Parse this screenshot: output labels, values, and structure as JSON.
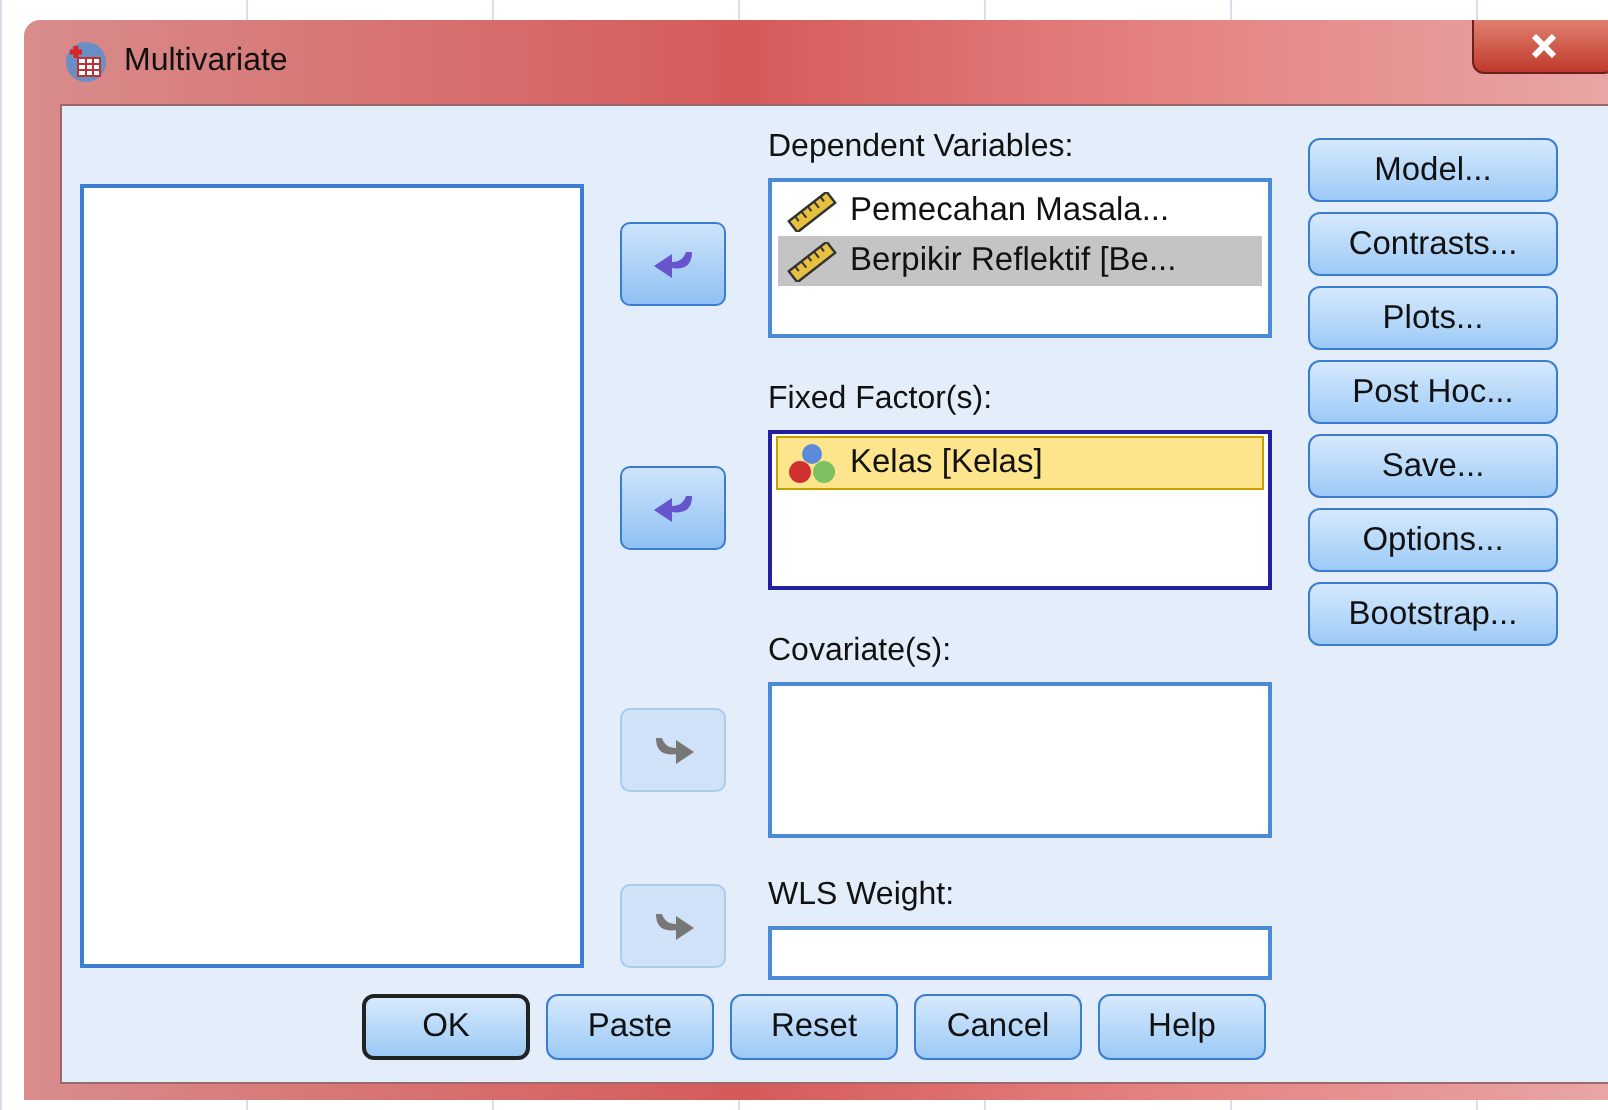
{
  "window": {
    "title": "Multivariate"
  },
  "move_buttons": [
    {
      "kind": "left",
      "disabled": false
    },
    {
      "kind": "left",
      "disabled": false
    },
    {
      "kind": "right",
      "disabled": true
    },
    {
      "kind": "right",
      "disabled": true
    }
  ],
  "target_lists": [
    {
      "label": "Dependent Variables:",
      "focused": false,
      "items": [
        {
          "name": "Pemecahan Masala...",
          "kind": "scale",
          "selected": false
        },
        {
          "name": "Berpikir Reflektif [Be...",
          "kind": "scale",
          "selected": true
        }
      ]
    },
    {
      "label": "Fixed Factor(s):",
      "focused": true,
      "items": [
        {
          "name": "Kelas [Kelas]",
          "kind": "nominal",
          "selected": true
        }
      ]
    },
    {
      "label": "Covariate(s):",
      "focused": false
    }
  ],
  "wls_weight": {
    "label": "WLS Weight:"
  },
  "side_buttons": [
    "Model...",
    "Contrasts...",
    "Plots...",
    "Post Hoc...",
    "Save...",
    "Options...",
    "Bootstrap..."
  ],
  "bottom_buttons": [
    {
      "label": "OK",
      "default": true
    },
    {
      "label": "Paste",
      "default": false
    },
    {
      "label": "Reset",
      "default": false
    },
    {
      "label": "Cancel",
      "default": false
    },
    {
      "label": "Help",
      "default": false
    }
  ]
}
